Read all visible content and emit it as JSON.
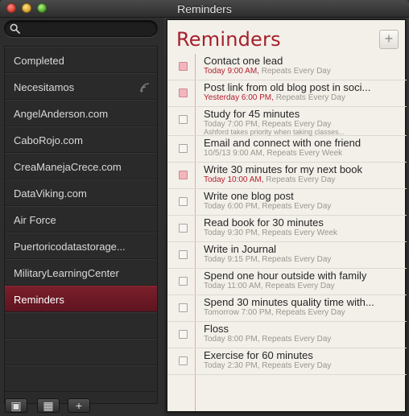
{
  "window": {
    "title": "Reminders"
  },
  "search": {
    "placeholder": "",
    "value": ""
  },
  "sidebar": {
    "lists": [
      {
        "label": "Completed",
        "selected": false,
        "shared": false
      },
      {
        "label": "Necesitamos",
        "selected": false,
        "shared": true
      },
      {
        "label": "AngelAnderson.com",
        "selected": false,
        "shared": false
      },
      {
        "label": "CaboRojo.com",
        "selected": false,
        "shared": false
      },
      {
        "label": "CreaManejaCrece.com",
        "selected": false,
        "shared": false
      },
      {
        "label": "DataViking.com",
        "selected": false,
        "shared": false
      },
      {
        "label": "Air Force",
        "selected": false,
        "shared": false
      },
      {
        "label": "Puertoricodatastorage...",
        "selected": false,
        "shared": false
      },
      {
        "label": "MilitaryLearningCenter",
        "selected": false,
        "shared": false
      },
      {
        "label": "Reminders",
        "selected": true,
        "shared": false
      }
    ],
    "bottom_buttons": [
      {
        "icon": "show-calendar-icon",
        "glyph": "▣"
      },
      {
        "icon": "calendar-grid-icon",
        "glyph": "▦"
      },
      {
        "icon": "add-list-icon",
        "glyph": "+"
      }
    ]
  },
  "main": {
    "title": "Reminders",
    "add_label": "+",
    "reminders": [
      {
        "title": "Contact one lead",
        "due": "Today 9:00 AM,",
        "repeat": "Repeats Every Day",
        "overdue": true,
        "note": ""
      },
      {
        "title": "Post link from old blog post in soci...",
        "due": "Yesterday 6:00 PM,",
        "repeat": "Repeats Every Day",
        "overdue": true,
        "note": ""
      },
      {
        "title": "Study for 45 minutes",
        "due": "Today 7:00 PM,",
        "repeat": "Repeats Every Day",
        "overdue": false,
        "note": "Ashford takes priority when taking classes..."
      },
      {
        "title": "Email and connect with one friend",
        "due": "10/5/13 9:00 AM,",
        "repeat": "Repeats Every Week",
        "overdue": false,
        "note": ""
      },
      {
        "title": "Write 30 minutes for my next book",
        "due": "Today 10:00 AM,",
        "repeat": "Repeats Every Day",
        "overdue": true,
        "note": ""
      },
      {
        "title": "Write one blog post",
        "due": "Today 6:00 PM,",
        "repeat": "Repeats Every Day",
        "overdue": false,
        "note": ""
      },
      {
        "title": "Read book for 30 minutes",
        "due": "Today 9:30 PM,",
        "repeat": "Repeats Every Week",
        "overdue": false,
        "note": ""
      },
      {
        "title": "Write in Journal",
        "due": "Today 9:15 PM,",
        "repeat": "Repeats Every Day",
        "overdue": false,
        "note": ""
      },
      {
        "title": "Spend one hour outside with family",
        "due": "Today 11:00 AM,",
        "repeat": "Repeats Every Day",
        "overdue": false,
        "note": ""
      },
      {
        "title": "Spend 30 minutes quality time with...",
        "due": "Tomorrow 7:00 PM,",
        "repeat": "Repeats Every Day",
        "overdue": false,
        "note": ""
      },
      {
        "title": "Floss",
        "due": "Today 8:00 PM,",
        "repeat": "Repeats Every Day",
        "overdue": false,
        "note": ""
      },
      {
        "title": "Exercise for 60 minutes",
        "due": "Today 2:30 PM,",
        "repeat": "Repeats Every Day",
        "overdue": false,
        "note": ""
      }
    ]
  },
  "colors": {
    "accent": "#a5202b",
    "selected_list": "#6c1a26",
    "overdue_checkbox": "#f2b6bc"
  }
}
